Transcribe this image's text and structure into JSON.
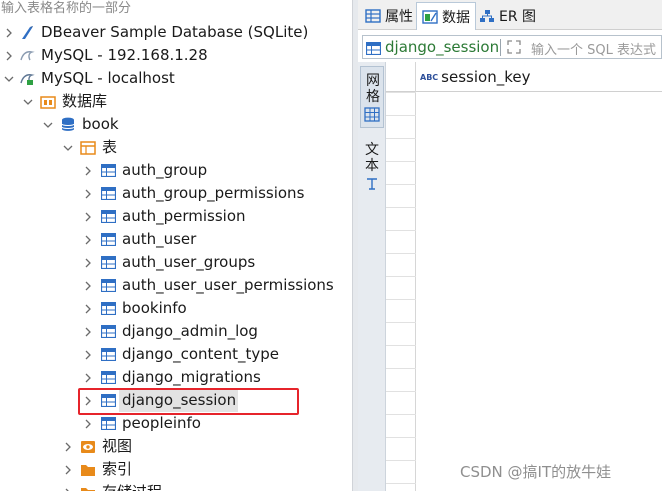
{
  "navigator": {
    "filter_placeholder": "输入表格名称的一部分",
    "connections": [
      {
        "label": "DBeaver Sample Database (SQLite)"
      },
      {
        "label": "MySQL - 192.168.1.28"
      },
      {
        "label": "MySQL - localhost"
      }
    ],
    "databases_label": "数据库",
    "schema_label": "book",
    "tables_label": "表",
    "tables": [
      "auth_group",
      "auth_group_permissions",
      "auth_permission",
      "auth_user",
      "auth_user_groups",
      "auth_user_user_permissions",
      "bookinfo",
      "django_admin_log",
      "django_content_type",
      "django_migrations",
      "django_session",
      "peopleinfo"
    ],
    "selected_table": "django_session",
    "views_label": "视图",
    "indexes_label": "索引",
    "procedures_label": "存储过程"
  },
  "editor": {
    "tabs": [
      {
        "label": "属性",
        "icon": "properties-icon",
        "active": false
      },
      {
        "label": "数据",
        "icon": "data-icon",
        "active": true
      },
      {
        "label": "ER 图",
        "icon": "er-diagram-icon",
        "active": false
      }
    ],
    "table_name": "django_session",
    "filter_placeholder": "输入一个 SQL 表达式",
    "side_panels": {
      "grid": "网格",
      "text": "文本"
    },
    "columns": [
      "session_key"
    ],
    "column_type_badge": "ABC"
  },
  "watermark": "CSDN @搞IT的放牛娃",
  "colors": {
    "highlight_box": "#e6242b",
    "table_icon": "#2f6fc4",
    "folder_icon": "#e88a1a",
    "accent_green": "#2c7a36"
  }
}
